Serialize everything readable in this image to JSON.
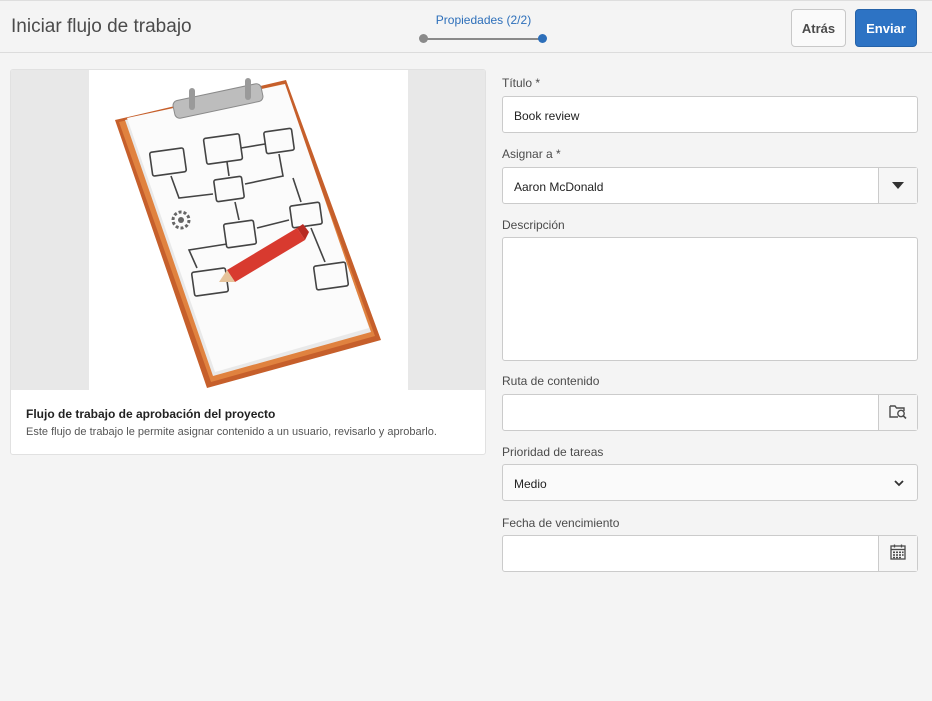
{
  "header": {
    "title": "Iniciar flujo de trabajo",
    "step_label": "Propiedades (2/2)",
    "back_label": "Atrás",
    "submit_label": "Enviar"
  },
  "card": {
    "title": "Flujo de trabajo de aprobación del proyecto",
    "description": "Este flujo de trabajo le permite asignar contenido a un usuario, revisarlo y aprobarlo."
  },
  "form": {
    "title_label": "Título *",
    "title_value": "Book review",
    "assign_label": "Asignar a *",
    "assign_value": "Aaron McDonald",
    "description_label": "Descripción",
    "description_value": "",
    "content_path_label": "Ruta de contenido",
    "content_path_value": "",
    "priority_label": "Prioridad de tareas",
    "priority_value": "Medio",
    "due_date_label": "Fecha de vencimiento",
    "due_date_value": ""
  },
  "icons": {
    "assign": "triangle-down-icon",
    "content_path": "folder-search-icon",
    "priority": "chevron-down-icon",
    "due_date": "calendar-icon"
  },
  "colors": {
    "accent": "#2d73c4",
    "wizard_active": "#2d6fba",
    "background": "#f4f4f4"
  }
}
